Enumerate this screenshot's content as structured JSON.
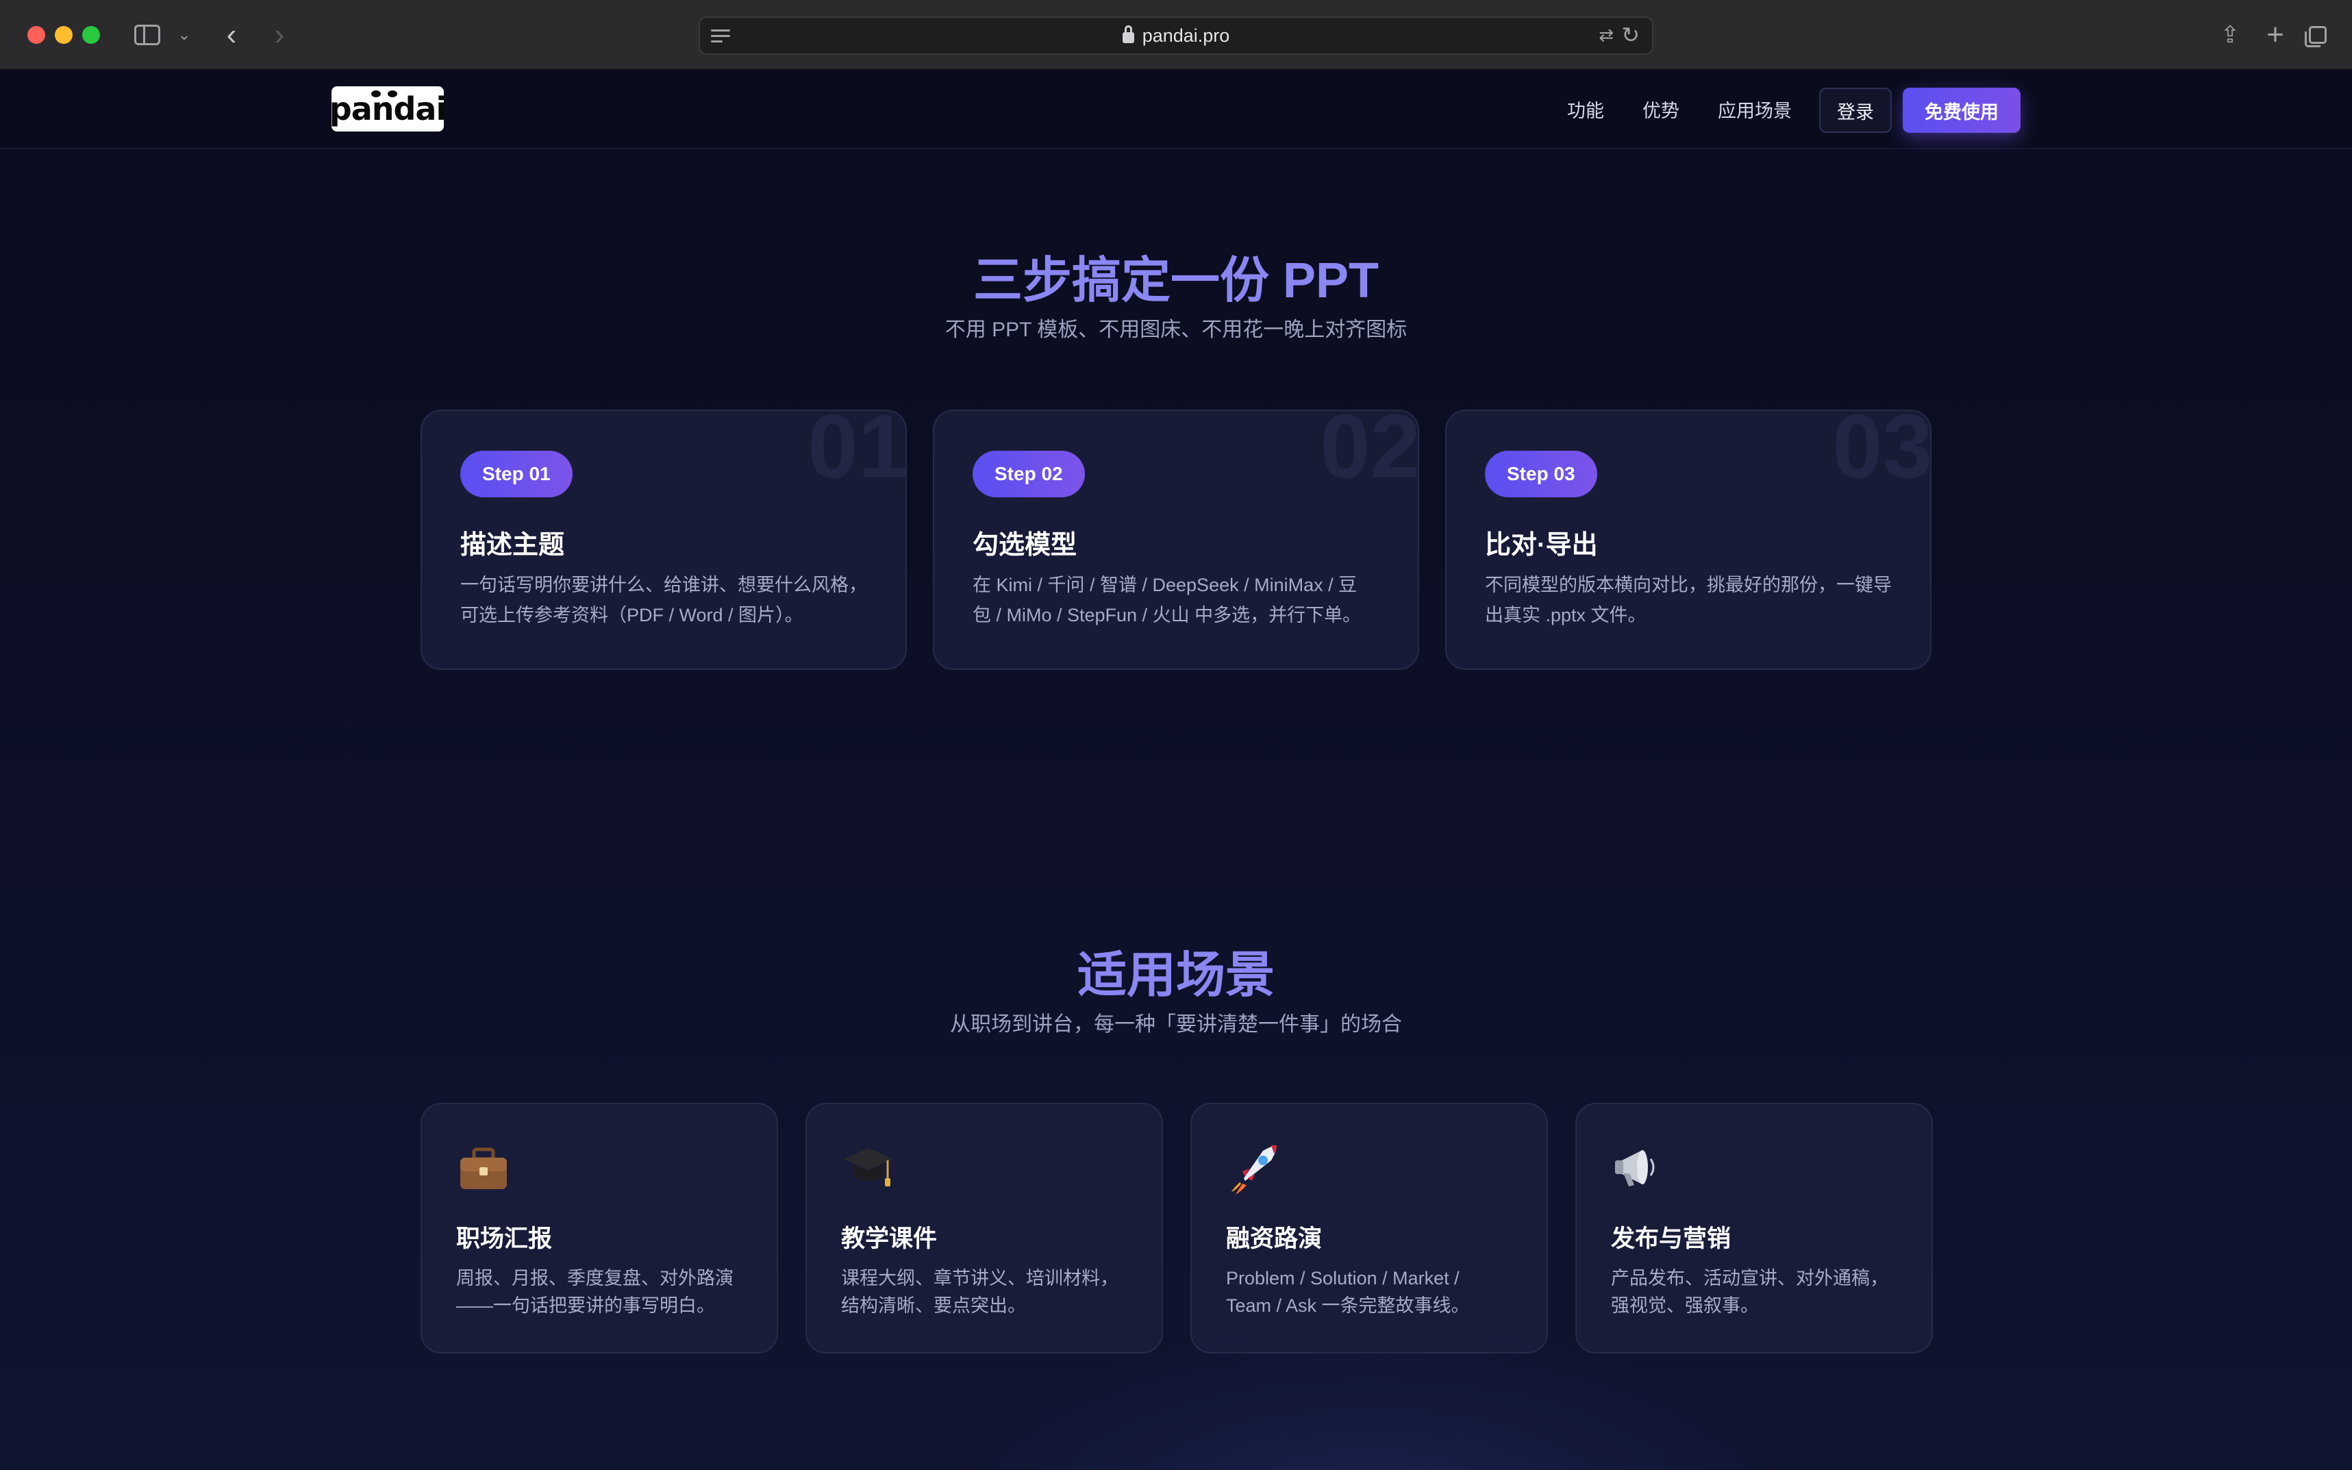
{
  "browser": {
    "url": "pandai.pro"
  },
  "nav": {
    "logo": "pandai",
    "links": [
      "功能",
      "优势",
      "应用场景"
    ],
    "login": "登录",
    "cta": "免费使用"
  },
  "steps_section": {
    "title": "三步搞定一份 PPT",
    "subtitle": "不用 PPT 模板、不用图床、不用花一晚上对齐图标",
    "steps": [
      {
        "number": "01",
        "badge": "Step 01",
        "title": "描述主题",
        "desc_line1": "一句话写明你要讲什么、给谁讲、想要什么风格，",
        "desc_line2": "可选上传参考资料（PDF / Word / 图片）。"
      },
      {
        "number": "02",
        "badge": "Step 02",
        "title": "勾选模型",
        "desc_line1": "在 Kimi / 千问 / 智谱 / DeepSeek / MiniMax / 豆",
        "desc_line2": "包 / MiMo / StepFun / 火山 中多选，并行下单。"
      },
      {
        "number": "03",
        "badge": "Step 03",
        "title": "比对·导出",
        "desc_line1": "不同模型的版本横向对比，挑最好的那份，一键导",
        "desc_line2": "出真实 .pptx 文件。"
      }
    ]
  },
  "scenes_section": {
    "title": "适用场景",
    "subtitle": "从职场到讲台，每一种「要讲清楚一件事」的场合",
    "scenes": [
      {
        "icon": "briefcase-icon",
        "title": "职场汇报",
        "desc_line1": "周报、月报、季度复盘、对外路演",
        "desc_line2": "——一句话把要讲的事写明白。"
      },
      {
        "icon": "graduation-cap-icon",
        "title": "教学课件",
        "desc_line1": "课程大纲、章节讲义、培训材料，",
        "desc_line2": "结构清晰、要点突出。"
      },
      {
        "icon": "rocket-icon",
        "title": "融资路演",
        "desc_line1": "Problem / Solution / Market /",
        "desc_line2": "Team / Ask 一条完整故事线。"
      },
      {
        "icon": "megaphone-icon",
        "title": "发布与营销",
        "desc_line1": "产品发布、活动宣讲、对外通稿，",
        "desc_line2": "强视觉、强叙事。"
      }
    ]
  },
  "colors": {
    "accent": "#6c5cf0",
    "title": "#8a86f2",
    "background": "#0b0d1f"
  }
}
